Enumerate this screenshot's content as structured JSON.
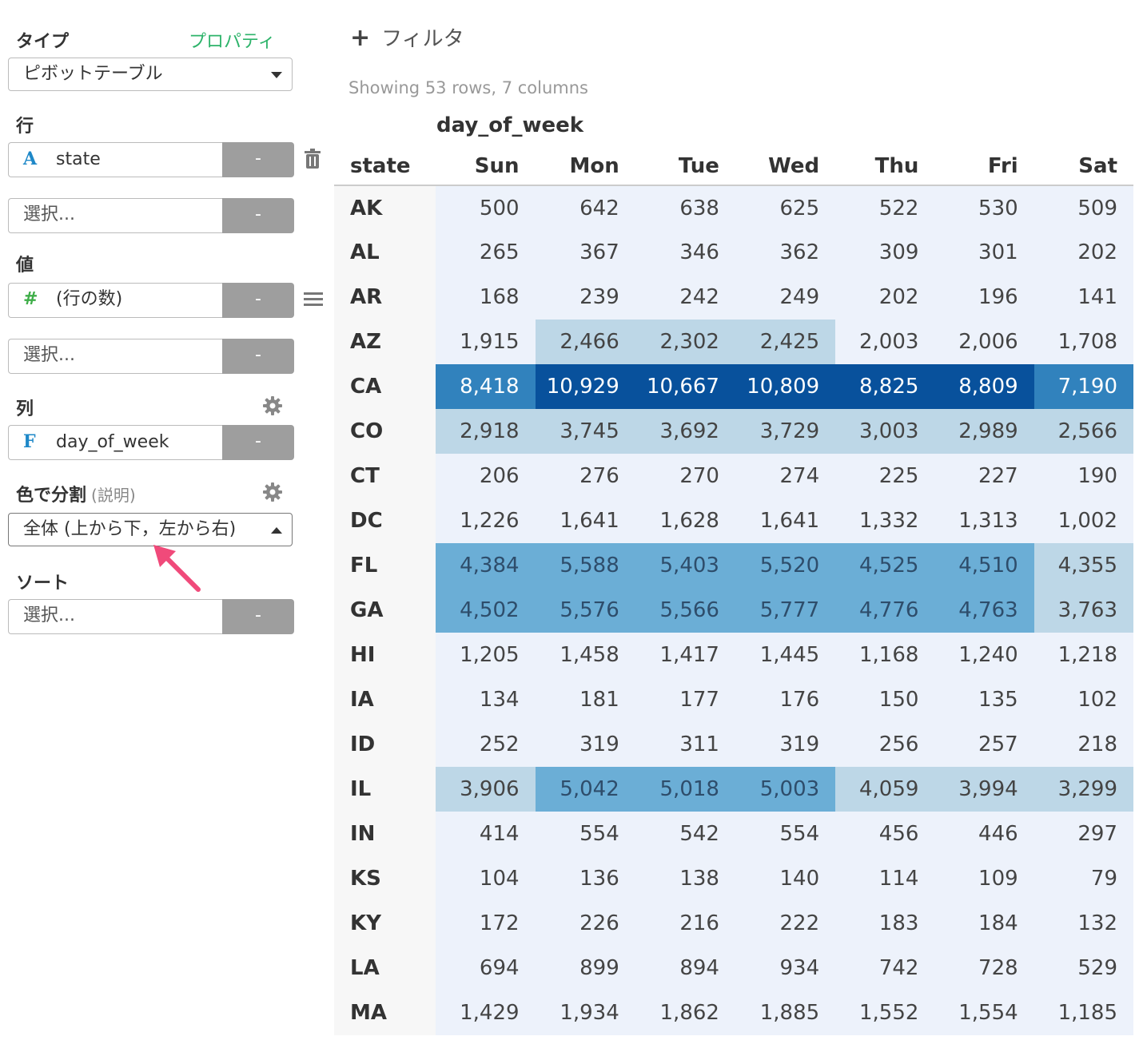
{
  "sidebar": {
    "type_label": "タイプ",
    "properties_link": "プロパティ",
    "type_value": "ピボットテーブル",
    "rows_label": "行",
    "rows_field": "state",
    "rows_field_type": "A",
    "rows_select_placeholder": "選択...",
    "values_label": "値",
    "values_field": "(行の数)",
    "values_field_type": "#",
    "values_select_placeholder": "選択...",
    "columns_label": "列",
    "columns_field": "day_of_week",
    "columns_field_type": "F",
    "color_label": "色で分割",
    "color_label_sub": "(説明)",
    "color_value": "全体 (上から下，左から右)",
    "sort_label": "ソート",
    "sort_placeholder": "選択...",
    "remove_button_label": "-"
  },
  "main": {
    "filter_label": "フィルタ",
    "rows_info": "Showing 53 rows, 7 columns",
    "column_group": "day_of_week",
    "row_header": "state"
  },
  "colors": {
    "accent": "#2db36a",
    "scale": [
      "#edf2fb",
      "#bdd7e7",
      "#6baed6",
      "#3182bd",
      "#08519c"
    ]
  },
  "chart_data": {
    "type": "table",
    "columns": [
      "Sun",
      "Mon",
      "Tue",
      "Wed",
      "Thu",
      "Fri",
      "Sat"
    ],
    "rows": [
      {
        "state": "AK",
        "values": [
          "500",
          "642",
          "638",
          "625",
          "522",
          "530",
          "509"
        ],
        "levels": [
          0,
          0,
          0,
          0,
          0,
          0,
          0
        ]
      },
      {
        "state": "AL",
        "values": [
          "265",
          "367",
          "346",
          "362",
          "309",
          "301",
          "202"
        ],
        "levels": [
          0,
          0,
          0,
          0,
          0,
          0,
          0
        ]
      },
      {
        "state": "AR",
        "values": [
          "168",
          "239",
          "242",
          "249",
          "202",
          "196",
          "141"
        ],
        "levels": [
          0,
          0,
          0,
          0,
          0,
          0,
          0
        ]
      },
      {
        "state": "AZ",
        "values": [
          "1,915",
          "2,466",
          "2,302",
          "2,425",
          "2,003",
          "2,006",
          "1,708"
        ],
        "levels": [
          0,
          1,
          1,
          1,
          0,
          0,
          0
        ]
      },
      {
        "state": "CA",
        "values": [
          "8,418",
          "10,929",
          "10,667",
          "10,809",
          "8,825",
          "8,809",
          "7,190"
        ],
        "levels": [
          3,
          4,
          4,
          4,
          4,
          4,
          3
        ]
      },
      {
        "state": "CO",
        "values": [
          "2,918",
          "3,745",
          "3,692",
          "3,729",
          "3,003",
          "2,989",
          "2,566"
        ],
        "levels": [
          1,
          1,
          1,
          1,
          1,
          1,
          1
        ]
      },
      {
        "state": "CT",
        "values": [
          "206",
          "276",
          "270",
          "274",
          "225",
          "227",
          "190"
        ],
        "levels": [
          0,
          0,
          0,
          0,
          0,
          0,
          0
        ]
      },
      {
        "state": "DC",
        "values": [
          "1,226",
          "1,641",
          "1,628",
          "1,641",
          "1,332",
          "1,313",
          "1,002"
        ],
        "levels": [
          0,
          0,
          0,
          0,
          0,
          0,
          0
        ]
      },
      {
        "state": "FL",
        "values": [
          "4,384",
          "5,588",
          "5,403",
          "5,520",
          "4,525",
          "4,510",
          "4,355"
        ],
        "levels": [
          2,
          2,
          2,
          2,
          2,
          2,
          1
        ]
      },
      {
        "state": "GA",
        "values": [
          "4,502",
          "5,576",
          "5,566",
          "5,777",
          "4,776",
          "4,763",
          "3,763"
        ],
        "levels": [
          2,
          2,
          2,
          2,
          2,
          2,
          1
        ]
      },
      {
        "state": "HI",
        "values": [
          "1,205",
          "1,458",
          "1,417",
          "1,445",
          "1,168",
          "1,240",
          "1,218"
        ],
        "levels": [
          0,
          0,
          0,
          0,
          0,
          0,
          0
        ]
      },
      {
        "state": "IA",
        "values": [
          "134",
          "181",
          "177",
          "176",
          "150",
          "135",
          "102"
        ],
        "levels": [
          0,
          0,
          0,
          0,
          0,
          0,
          0
        ]
      },
      {
        "state": "ID",
        "values": [
          "252",
          "319",
          "311",
          "319",
          "256",
          "257",
          "218"
        ],
        "levels": [
          0,
          0,
          0,
          0,
          0,
          0,
          0
        ]
      },
      {
        "state": "IL",
        "values": [
          "3,906",
          "5,042",
          "5,018",
          "5,003",
          "4,059",
          "3,994",
          "3,299"
        ],
        "levels": [
          1,
          2,
          2,
          2,
          1,
          1,
          1
        ]
      },
      {
        "state": "IN",
        "values": [
          "414",
          "554",
          "542",
          "554",
          "456",
          "446",
          "297"
        ],
        "levels": [
          0,
          0,
          0,
          0,
          0,
          0,
          0
        ]
      },
      {
        "state": "KS",
        "values": [
          "104",
          "136",
          "138",
          "140",
          "114",
          "109",
          "79"
        ],
        "levels": [
          0,
          0,
          0,
          0,
          0,
          0,
          0
        ]
      },
      {
        "state": "KY",
        "values": [
          "172",
          "226",
          "216",
          "222",
          "183",
          "184",
          "132"
        ],
        "levels": [
          0,
          0,
          0,
          0,
          0,
          0,
          0
        ]
      },
      {
        "state": "LA",
        "values": [
          "694",
          "899",
          "894",
          "934",
          "742",
          "728",
          "529"
        ],
        "levels": [
          0,
          0,
          0,
          0,
          0,
          0,
          0
        ]
      },
      {
        "state": "MA",
        "values": [
          "1,429",
          "1,934",
          "1,862",
          "1,885",
          "1,552",
          "1,554",
          "1,185"
        ],
        "levels": [
          0,
          0,
          0,
          0,
          0,
          0,
          0
        ]
      }
    ]
  }
}
